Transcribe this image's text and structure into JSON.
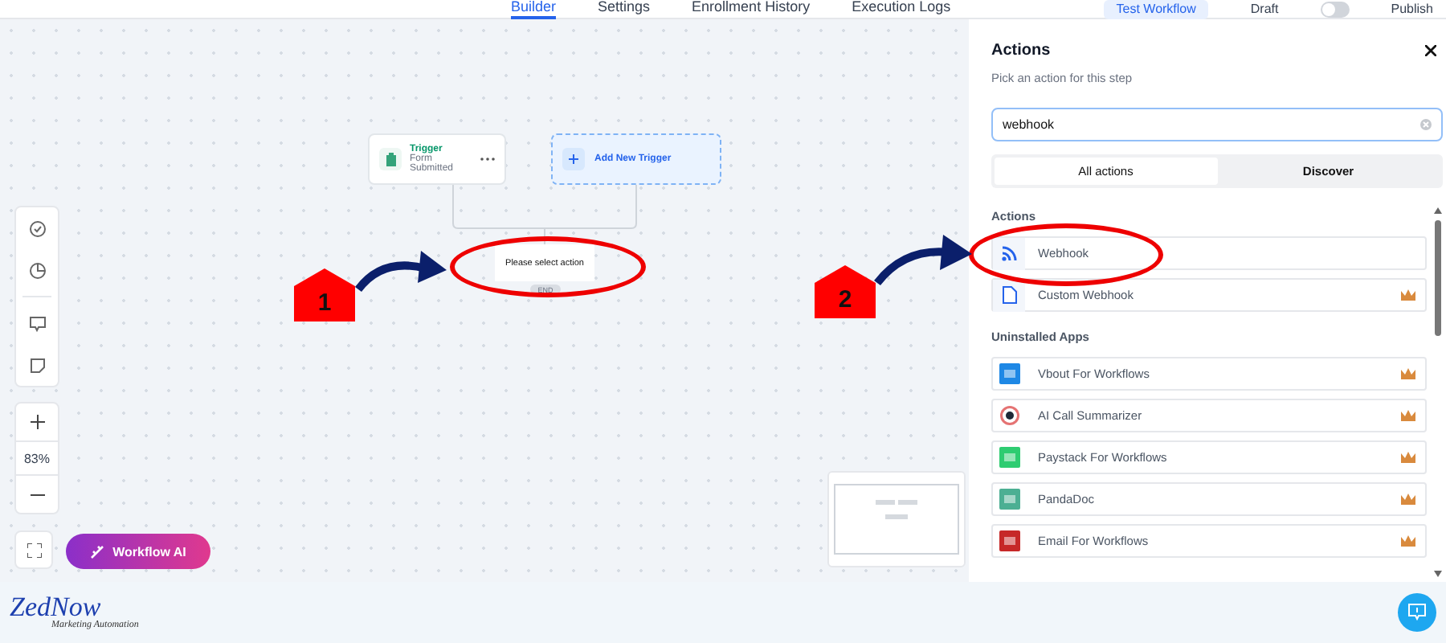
{
  "top_tabs": [
    {
      "label": "Builder",
      "selected": true
    },
    {
      "label": "Settings",
      "selected": false
    },
    {
      "label": "Enrollment History",
      "selected": false
    },
    {
      "label": "Execution Logs",
      "selected": false
    }
  ],
  "test_button": "Test Workflow",
  "publish_toggle": {
    "off_label": "Draft",
    "on_label": "Publish",
    "on": false
  },
  "canvas": {
    "trigger": {
      "title": "Trigger",
      "subtitle": "Form Submitted"
    },
    "add_trigger": "Add New Trigger",
    "action_node": "Please select action",
    "end_label": "END",
    "zoom": "83%",
    "ai_button": "Workflow AI"
  },
  "annotations": [
    {
      "number": "1"
    },
    {
      "number": "2"
    }
  ],
  "panel": {
    "title": "Actions",
    "subtitle": "Pick an action for this step",
    "search": "webhook",
    "tabs": [
      {
        "label": "All actions",
        "selected": true
      },
      {
        "label": "Discover",
        "selected": false
      }
    ],
    "sections": [
      {
        "heading": "Actions",
        "items": [
          {
            "label": "Webhook",
            "kind": "rss",
            "premium": false
          },
          {
            "label": "Custom Webhook",
            "kind": "document",
            "premium": true
          }
        ]
      },
      {
        "heading": "Uninstalled Apps",
        "items": [
          {
            "label": "Vbout For Workflows",
            "kind": "app",
            "color": "#1e88e5",
            "premium": true
          },
          {
            "label": "AI Call Summarizer",
            "kind": "round",
            "color": "#e57373",
            "premium": true
          },
          {
            "label": "Paystack For Workflows",
            "kind": "app",
            "color": "#2ecc71",
            "premium": true
          },
          {
            "label": "PandaDoc",
            "kind": "app",
            "color": "#4caf93",
            "premium": true
          },
          {
            "label": "Email For Workflows",
            "kind": "app",
            "color": "#c62828",
            "premium": true
          }
        ]
      }
    ]
  },
  "logo": {
    "name": "ZedNow",
    "tagline": "Marketing Automation"
  }
}
